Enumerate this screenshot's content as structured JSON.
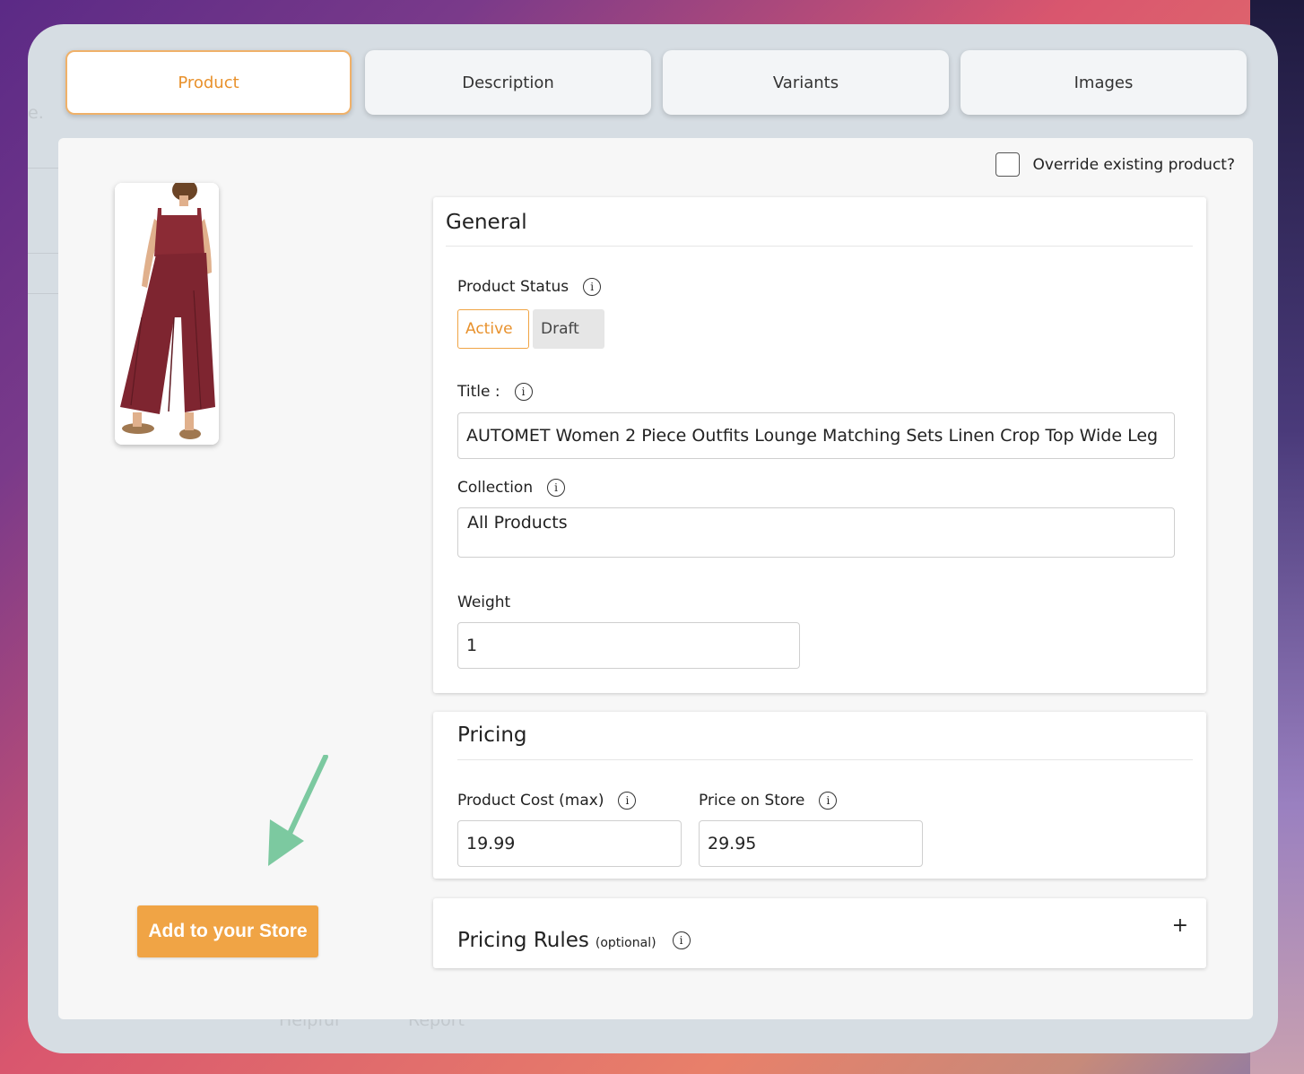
{
  "tabs": [
    {
      "label": "Product",
      "active": true
    },
    {
      "label": "Description",
      "active": false
    },
    {
      "label": "Variants",
      "active": false
    },
    {
      "label": "Images",
      "active": false
    }
  ],
  "override": {
    "label": "Override existing product?",
    "checked": false
  },
  "add_button": {
    "label": "Add to your Store"
  },
  "general": {
    "title": "General",
    "product_status": {
      "label": "Product Status",
      "options": [
        "Active",
        "Draft"
      ],
      "selected": "Active"
    },
    "title_field": {
      "label": "Title :",
      "value": "AUTOMET Women 2 Piece Outfits Lounge Matching Sets Linen Crop Top Wide Leg"
    },
    "collection": {
      "label": "Collection",
      "value": "All Products"
    },
    "weight": {
      "label": "Weight",
      "value": "1"
    }
  },
  "pricing": {
    "title": "Pricing",
    "cost": {
      "label": "Product Cost (max)",
      "value": "19.99"
    },
    "price": {
      "label": "Price on Store",
      "value": "29.95"
    }
  },
  "pricing_rules": {
    "title": "Pricing Rules",
    "optional": "(optional)",
    "expand": "+"
  },
  "background_ghost": {
    "left_text": "e.",
    "helpful": "Helpful",
    "report": "Report"
  },
  "icons": {
    "info": "i",
    "arrow": "arrow-down-left-icon"
  },
  "colors": {
    "accent": "#f0a445",
    "accent_text": "#e8912c",
    "arrow": "#7cc9a0",
    "garment": "#8b2b35"
  }
}
